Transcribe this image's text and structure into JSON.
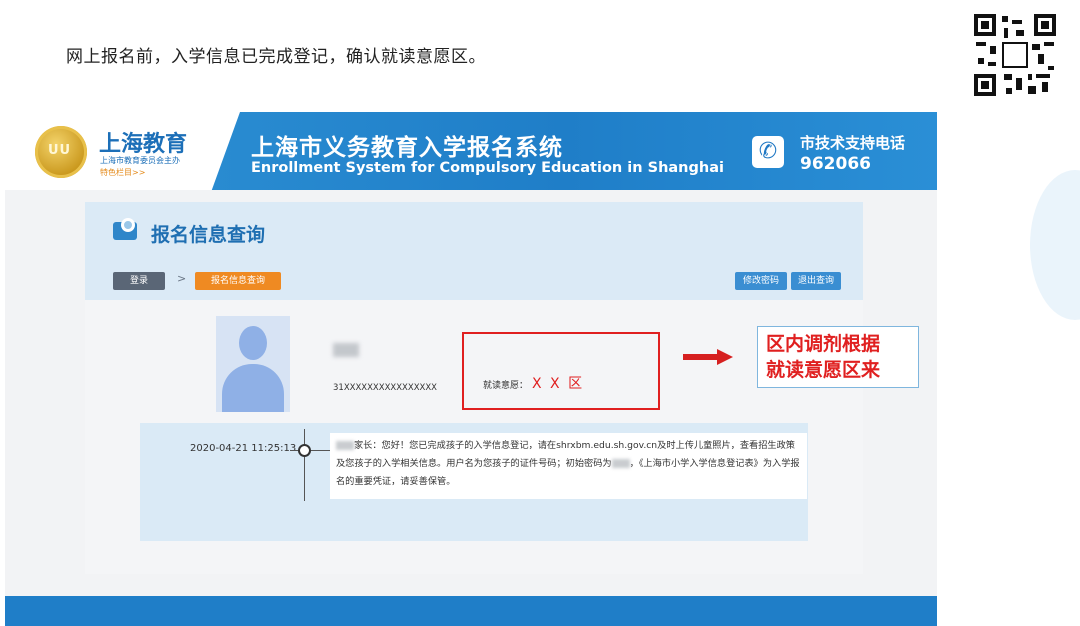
{
  "caption": "网上报名前，入学信息已完成登记，确认就读意愿区。",
  "header": {
    "logo_title": "上海教育",
    "logo_subtitle": "上海市教育委员会主办",
    "logo_link": "特色栏目>>",
    "system_title": "上海市义务教育入学报名系统",
    "system_title_en": "Enrollment System for Compulsory Education in Shanghai",
    "support_title": "市技术支持电话",
    "support_phone": "962066",
    "phone_icon": "phone-icon"
  },
  "panel": {
    "title": "报名信息查询",
    "breadcrumb": {
      "login": "登录",
      "separator": ">",
      "current": "报名信息查询"
    },
    "buttons": {
      "change_password": "修改密码",
      "logout_query": "退出查询"
    },
    "student": {
      "id_number": "31XXXXXXXXXXXXXXXX",
      "willingness_label": "就读意愿：",
      "willingness_value": "X X 区"
    },
    "timeline": {
      "time": "2020-04-21 11:25:13",
      "message_p1": "家长：您好！您已完成孩子的入学信息登记，请在shrxbm.edu.sh.gov.cn及时上传儿童照片，查看招生政策及您孩子的入学相关信息。用户名为您孩子的证件号码；初始密码为",
      "message_p2": "，《上海市小学入学信息登记表》为入学报名的重要凭证，请妥善保管。"
    }
  },
  "annotation": {
    "line1": "区内调剂根据",
    "line2": "就读意愿区来"
  },
  "colors": {
    "header_blue": "#1f7ec8",
    "accent_orange": "#ef8a22",
    "highlight_red": "#e02020"
  }
}
